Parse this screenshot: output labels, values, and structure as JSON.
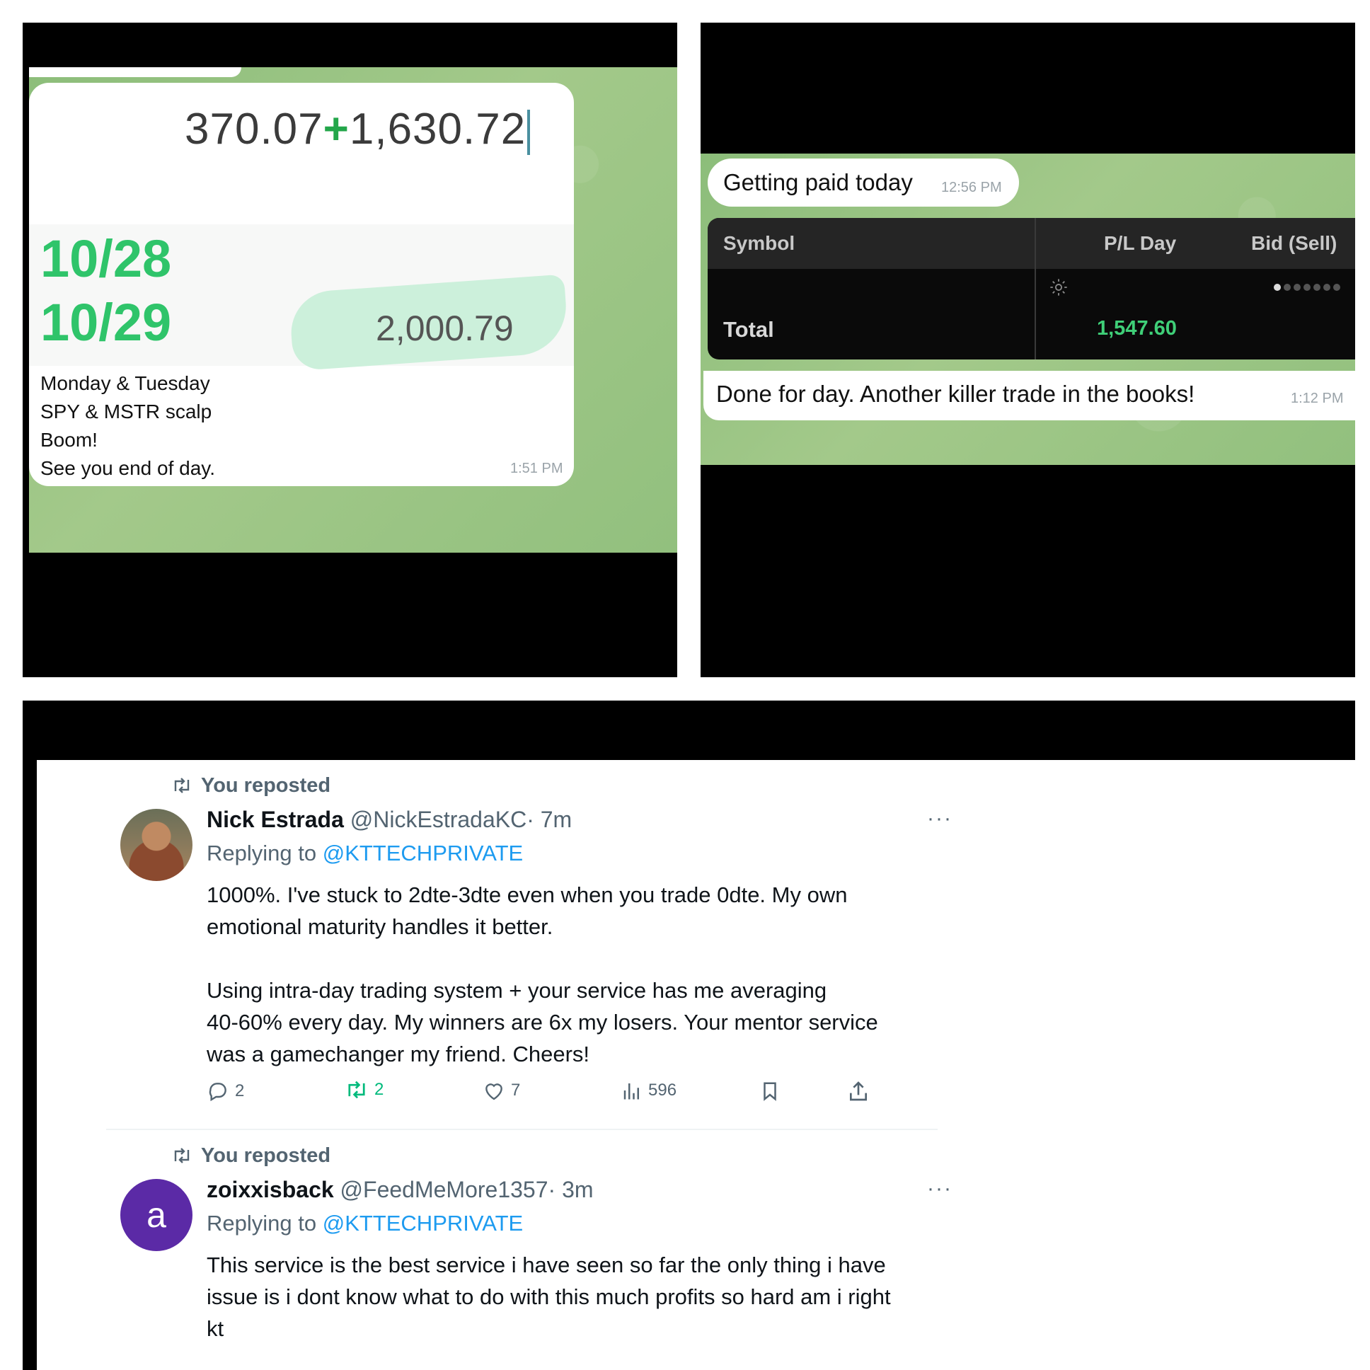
{
  "panel1": {
    "calc_left": "370.07",
    "calc_op": "+",
    "calc_right": "1,630.72",
    "date1": "10/28",
    "date2": "10/29",
    "result": "2,000.79",
    "caption": [
      "Monday & Tuesday",
      "SPY & MSTR scalp",
      "Boom!",
      "See you end of day."
    ],
    "time": "1:51 PM"
  },
  "panel2": {
    "msg_top": "Getting paid today",
    "msg_top_time": "12:56 PM",
    "table": {
      "col_symbol": "Symbol",
      "col_pl": "P/L Day",
      "col_bid": "Bid (Sell)",
      "total_label": "Total",
      "total_value": "1,547.60"
    },
    "msg_bottom": "Done for day. Another killer trade in the books!",
    "msg_bottom_time": "1:12 PM"
  },
  "tweets": [
    {
      "repost_label": "You reposted",
      "name": "Nick Estrada",
      "handle": "@NickEstradaKC",
      "time": "· 7m",
      "replying_prefix": "Replying to",
      "replying_to": "@KTTECHPRIVATE",
      "body": [
        "1000%. I've stuck to 2dte-3dte even when you trade 0dte. My own",
        "emotional maturity handles it better.",
        "",
        "Using intra-day trading system + your service has me averaging",
        "40-60% every day. My winners are 6x my losers. Your mentor service",
        "was a gamechanger my friend. Cheers!"
      ],
      "replies": "2",
      "reposts": "2",
      "likes": "7",
      "views": "596",
      "more": "···"
    },
    {
      "repost_label": "You reposted",
      "avatar_letter": "a",
      "name": "zoixxisback",
      "handle": "@FeedMeMore1357",
      "time": "· 3m",
      "replying_prefix": "Replying to",
      "replying_to": "@KTTECHPRIVATE",
      "body": [
        "This service is the best service i have seen so far the only thing i have",
        "issue is i dont know what to do with this much profits so hard am i right",
        "kt"
      ],
      "more": "···"
    }
  ],
  "colors": {
    "chat_green": "#8cbd7a",
    "profit_green": "#2fc46a",
    "link_blue": "#1d9bf0",
    "repost_green": "#00ba7c"
  }
}
